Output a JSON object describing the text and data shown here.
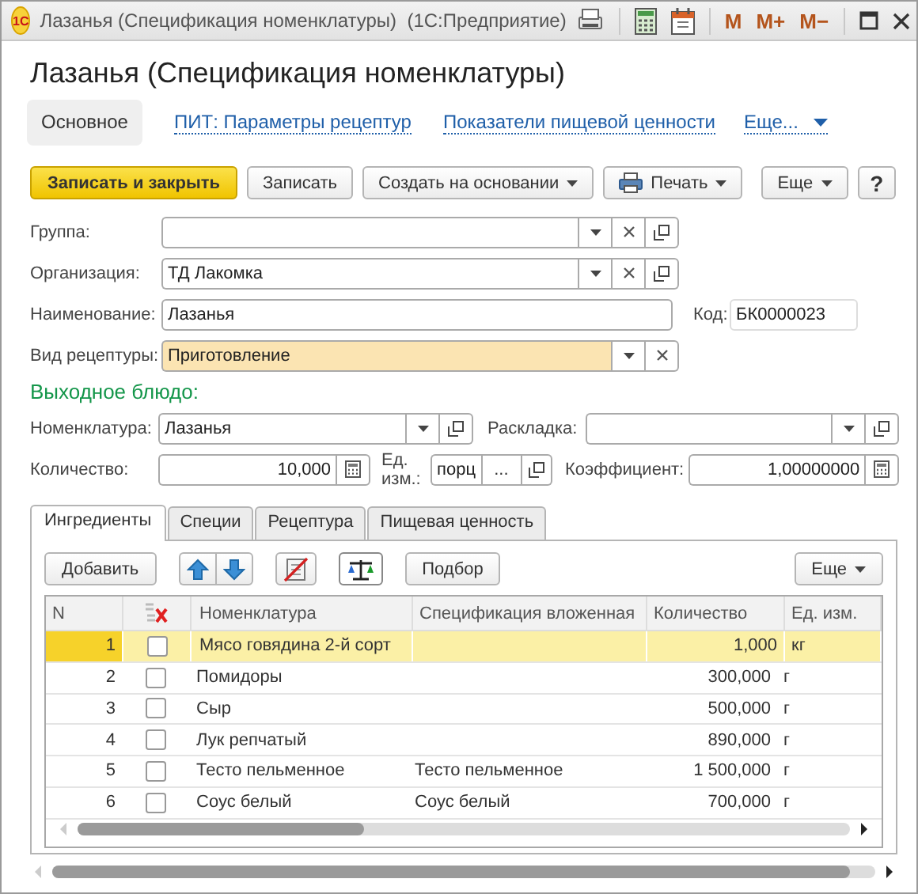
{
  "window": {
    "logo": "1С",
    "title": "Лазанья (Спецификация номенклатуры)  (1С:Предприятие)",
    "memory_buttons": [
      "M",
      "M+",
      "M−"
    ]
  },
  "form_title": "Лазанья (Спецификация номенклатуры)",
  "sections": [
    {
      "label": "Основное",
      "selected": true
    },
    {
      "label": "ПИТ: Параметры рецептур",
      "selected": false
    },
    {
      "label": "Показатели пищевой ценности",
      "selected": false
    }
  ],
  "more_sections": "Еще...",
  "commands": [
    {
      "kind": "primary",
      "label": "Записать и закрыть"
    },
    {
      "kind": "plain",
      "label": "Записать"
    },
    {
      "kind": "menu",
      "label": "Создать на основании"
    },
    {
      "kind": "print",
      "label": "Печать"
    }
  ],
  "more_commands": "Еще",
  "help": "?",
  "group": {
    "label": "Группа:"
  },
  "organization": {
    "label": "Организация:",
    "value": "ТД Лакомка"
  },
  "name": {
    "label": "Наименование:",
    "value": "Лазанья"
  },
  "code": {
    "label": "Код:",
    "value": "БК0000023"
  },
  "recipe_type": {
    "label": "Вид рецептуры:",
    "value": "Приготовление",
    "highlighted": true
  },
  "output_heading": "Выходное блюдо:",
  "nomenclature": {
    "label": "Номенклатура:",
    "value": "Лазанья"
  },
  "layout": {
    "label": "Раскладка:"
  },
  "quantity": {
    "label": "Количество:",
    "value": "10,000"
  },
  "unit": {
    "label": "Ед. изм.:",
    "value": "порц",
    "choose_label": "..."
  },
  "coefficient": {
    "label": "Коэффициент:",
    "value": "1,00000000"
  },
  "tabs": [
    {
      "label": "Ингредиенты",
      "selected": true
    },
    {
      "label": "Специи",
      "selected": false
    },
    {
      "label": "Рецептура",
      "selected": false
    },
    {
      "label": "Пищевая ценность",
      "selected": false
    }
  ],
  "table_toolbar": {
    "add": "Добавить",
    "toggles": [
      {
        "kind": "no-document",
        "on": false
      },
      {
        "kind": "scales",
        "on": true
      }
    ],
    "pick": "Подбор",
    "more": "Еще"
  },
  "table": {
    "columns": [
      "N",
      "Номенклатура",
      "Спецификация вложенная",
      "Количество",
      "Ед. изм."
    ],
    "rows": [
      {
        "n": "1",
        "checked": false,
        "nomenclature": "Мясо говядина 2-й сорт",
        "quantity": "1,000",
        "unit": "кг",
        "selected": true
      },
      {
        "n": "2",
        "checked": false,
        "nomenclature": "Помидоры",
        "quantity": "300,000",
        "unit": "г",
        "selected": false
      },
      {
        "n": "3",
        "checked": false,
        "nomenclature": "Сыр",
        "quantity": "500,000",
        "unit": "г",
        "selected": false
      },
      {
        "n": "4",
        "checked": false,
        "nomenclature": "Лук репчатый",
        "quantity": "890,000",
        "unit": "г",
        "selected": false
      },
      {
        "n": "5",
        "checked": false,
        "nomenclature": "Тесто пельменное",
        "nested_spec": "Тесто пельменное",
        "quantity": "1 500,000",
        "unit": "г",
        "selected": false
      },
      {
        "n": "6",
        "checked": false,
        "nomenclature": "Соус белый",
        "nested_spec": "Соус белый",
        "quantity": "700,000",
        "unit": "г",
        "selected": false
      }
    ]
  }
}
